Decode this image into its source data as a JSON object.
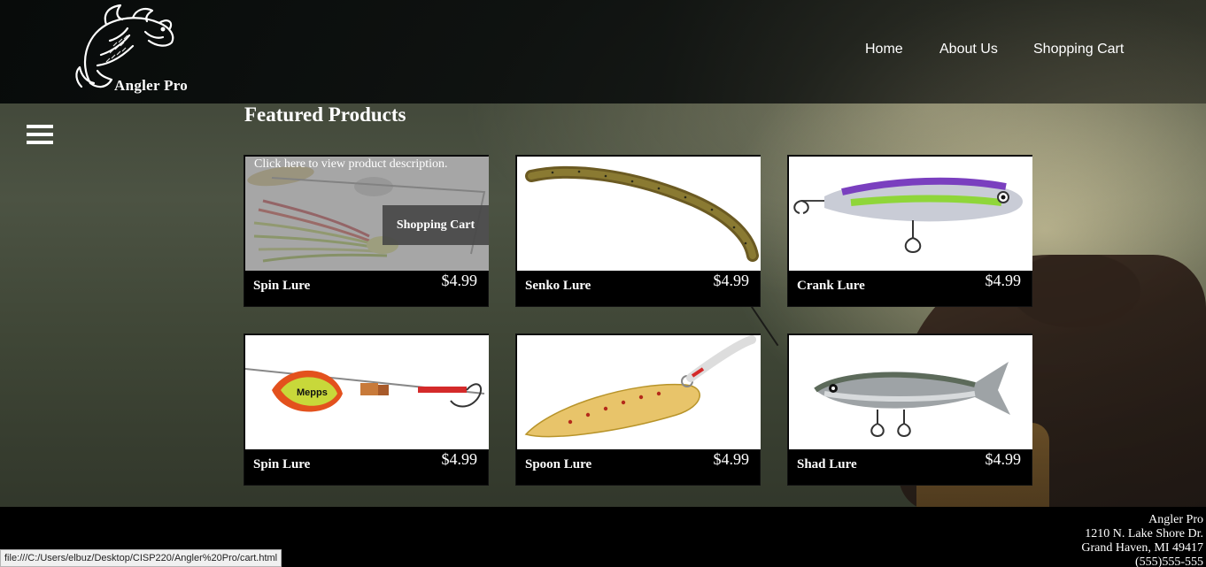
{
  "header": {
    "logo_text": "Angler Pro",
    "nav": [
      {
        "label": "Home"
      },
      {
        "label": "About Us"
      },
      {
        "label": "Shopping Cart"
      }
    ]
  },
  "main": {
    "title": "Featured Products",
    "hover_overlay": {
      "description_link": "Click here to view product description.",
      "cart_button": "Shopping Cart"
    },
    "products": [
      {
        "name": "Spin Lure",
        "price": "$4.99",
        "image": "spinnerbait-icon"
      },
      {
        "name": "Senko Lure",
        "price": "$4.99",
        "image": "worm-lure-icon"
      },
      {
        "name": "Crank Lure",
        "price": "$4.99",
        "image": "crankbait-icon"
      },
      {
        "name": "Spin Lure",
        "price": "$4.99",
        "image": "inline-spinner-icon"
      },
      {
        "name": "Spoon Lure",
        "price": "$4.99",
        "image": "spoon-lure-icon"
      },
      {
        "name": "Shad Lure",
        "price": "$4.99",
        "image": "shad-swimbait-icon"
      }
    ]
  },
  "footer": {
    "company": "Angler Pro",
    "street": "1210 N. Lake Shore Dr.",
    "city": "Grand Haven, MI 49417",
    "phone": "(555)555-555"
  },
  "status_bar": {
    "url": "file:///C:/Users/elbuz/Desktop/CISP220/Angler%20Pro/cart.html"
  },
  "colors": {
    "header_bg": "#0a0d0c",
    "card_bg": "#000000",
    "footer_bg": "#000000",
    "overlay_bg": "#808080"
  }
}
